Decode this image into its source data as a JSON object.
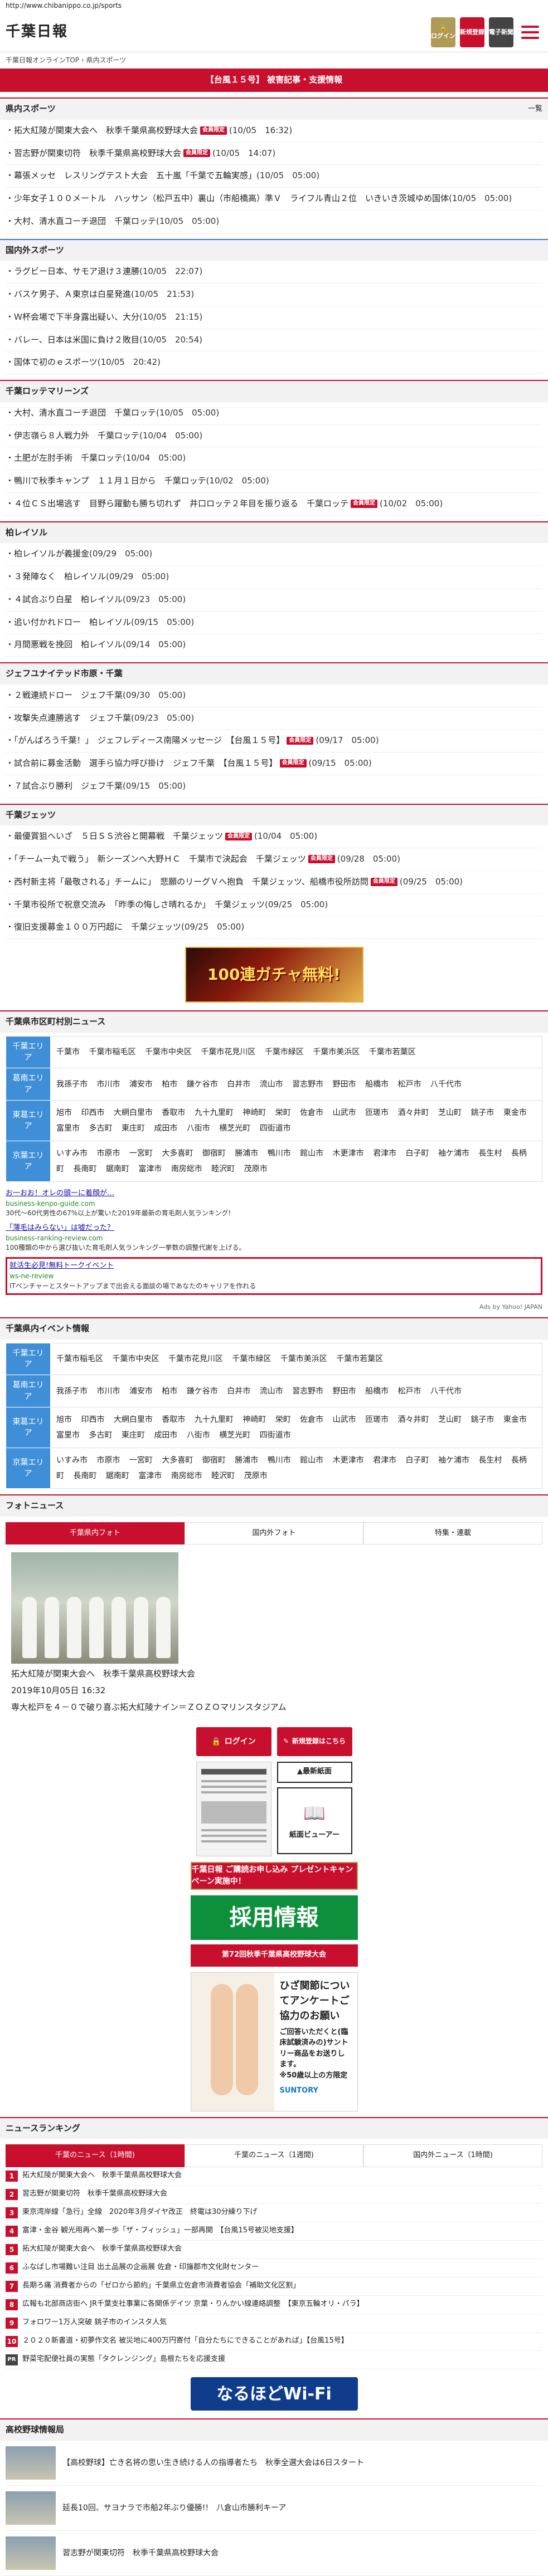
{
  "url": "http://www.chibanippo.co.jp/sports",
  "header": {
    "logo": "千葉日報",
    "login": "ログイン",
    "register": "新規登録",
    "eshimen": "電子新聞"
  },
  "breadcrumb": "千葉日報オンラインTOP › 県内スポーツ",
  "top_banner": "【台風１５号】 被害記事・支援情報",
  "sections": {
    "kennai": {
      "title": "県内スポーツ",
      "more": "一覧",
      "items": [
        {
          "text": "拓大紅陵が関東大会へ　秋季千葉県高校野球大会",
          "badge": "会員限定",
          "date": "(10/05　16:32)"
        },
        {
          "text": "習志野が関東切符　秋季千葉県高校野球大会",
          "badge": "会員限定",
          "date": "(10/05　14:07)"
        },
        {
          "text": "幕張メッセ　レスリングテスト大会　五十嵐「千葉で五輪実感」",
          "badge": "",
          "date": "(10/05　05:00)"
        },
        {
          "text": "少年女子１００メートル　ハッサン（松戸五中）裏山（市船橋高）準Ｖ　ライフル青山２位　いきいき茨城ゆめ国体",
          "badge": "",
          "date": "(10/05　05:00)"
        },
        {
          "text": "大村、清水直コーチ退団　千葉ロッテ",
          "badge": "",
          "date": "(10/05　05:00)"
        }
      ]
    },
    "kokunai": {
      "title": "国内外スポーツ",
      "items": [
        {
          "text": "ラグビー日本、サモア退け３連勝",
          "badge": "",
          "date": "(10/05　22:07)"
        },
        {
          "text": "バスケ男子、Ａ東京は白星発進",
          "badge": "",
          "date": "(10/05　21:53)"
        },
        {
          "text": "Ｗ杯会場で下半身露出疑い、大分",
          "badge": "",
          "date": "(10/05　21:15)"
        },
        {
          "text": "バレー、日本は米国に負け２敗目",
          "badge": "",
          "date": "(10/05　20:54)"
        },
        {
          "text": "国体で初のｅスポーツ",
          "badge": "",
          "date": "(10/05　20:42)"
        }
      ]
    },
    "lotte": {
      "title": "千葉ロッテマリーンズ",
      "items": [
        {
          "text": "大村、清水直コーチ退団　千葉ロッテ",
          "badge": "",
          "date": "(10/05　05:00)"
        },
        {
          "text": "伊志嶺ら８人戦力外　千葉ロッテ",
          "badge": "",
          "date": "(10/04　05:00)"
        },
        {
          "text": "土肥が左肘手術　千葉ロッテ",
          "badge": "",
          "date": "(10/04　05:00)"
        },
        {
          "text": "鴨川で秋季キャンプ　１１月１日から　千葉ロッテ",
          "badge": "",
          "date": "(10/02　05:00)"
        },
        {
          "text": "４位ＣＳ出場逃す　目野ら躍動も勝ち切れず　井口ロッテ２年目を振り返る　千葉ロッテ",
          "badge": "会員限定",
          "date": "(10/02　05:00)"
        }
      ]
    },
    "reysol": {
      "title": "柏レイソル",
      "items": [
        {
          "text": "柏レイソルが義援金",
          "badge": "",
          "date": "(09/29　05:00)"
        },
        {
          "text": "３発陣なく　柏レイソル",
          "badge": "",
          "date": "(09/29　05:00)"
        },
        {
          "text": "４試合ぶり白星　柏レイソル",
          "badge": "",
          "date": "(09/23　05:00)"
        },
        {
          "text": "追い付かれドロー　柏レイソル",
          "badge": "",
          "date": "(09/15　05:00)"
        },
        {
          "text": "月間悪戦を挽回　柏レイソル",
          "badge": "",
          "date": "(09/14　05:00)"
        }
      ]
    },
    "jef": {
      "title": "ジェフユナイテッド市原・千葉",
      "items": [
        {
          "text": "２戦連続ドロー　ジェフ千葉",
          "badge": "",
          "date": "(09/30　05:00)"
        },
        {
          "text": "攻撃失点連勝逃す　ジェフ千葉",
          "badge": "",
          "date": "(09/23　05:00)"
        },
        {
          "text": "「がんばろう千葉！」　ジェフレディース南陽メッセージ　【台風１５号】",
          "badge": "会員限定",
          "date": "(09/17　05:00)"
        },
        {
          "text": "試合前に募金活動　選手ら協力呼び掛け　ジェフ千葉　【台風１５号】",
          "badge": "会員限定",
          "date": "(09/15　05:00)"
        },
        {
          "text": "７試合ぶり勝利　ジェフ千葉",
          "badge": "",
          "date": "(09/15　05:00)"
        }
      ]
    },
    "jets": {
      "title": "千葉ジェッツ",
      "items": [
        {
          "text": "最優賞狙へいざ　５日ＳＳ渋谷と開幕戦　千葉ジェッツ",
          "badge": "会員限定",
          "date": "(10/04　05:00)"
        },
        {
          "text": "「チーム一丸で戦う」　新シーズンへ大野ＨＣ　千葉市で決起会　千葉ジェッツ",
          "badge": "会員限定",
          "date": "(09/28　05:00)"
        },
        {
          "text": "西村新主将「最敬される」チームに」　悲願のリーグＶへ抱負　千葉ジェッツ、船橋市役所訪問",
          "badge": "会員限定",
          "date": "(09/25　05:00)"
        },
        {
          "text": "千葉市役所で祝意交流み　「昨季の悔しさ晴れるか」　千葉ジェッツ",
          "badge": "",
          "date": "(09/25　05:00)"
        },
        {
          "text": "復旧支援募金１００万円超に　千葉ジェッツ",
          "badge": "",
          "date": "(09/25　05:00)"
        }
      ]
    }
  },
  "banner_ad": "100連ガチャ無料!",
  "region_news": {
    "title": "千葉県市区町村別ニュース",
    "rows": [
      {
        "area": "千葉エリア",
        "towns": [
          "千葉市",
          "千葉市稲毛区",
          "千葉市中央区",
          "千葉市花見川区",
          "千葉市緑区",
          "千葉市美浜区",
          "千葉市若葉区"
        ]
      },
      {
        "area": "葛南エリア",
        "towns": [
          "我孫子市",
          "市川市",
          "浦安市",
          "柏市",
          "鎌ケ谷市",
          "白井市",
          "流山市",
          "習志野市",
          "野田市",
          "船橋市",
          "松戸市",
          "八千代市"
        ]
      },
      {
        "area": "東葛エリア",
        "towns": [
          "旭市",
          "印西市",
          "大網白里市",
          "香取市",
          "九十九里町",
          "神崎町",
          "栄町",
          "佐倉市",
          "山武市",
          "匝瑳市",
          "酒々井町",
          "芝山町",
          "銚子市",
          "東金市",
          "富里市",
          "多古町",
          "東庄町",
          "成田市",
          "八街市",
          "横芝光町",
          "四街道市"
        ]
      },
      {
        "area": "京葉エリア",
        "towns": [
          "いすみ市",
          "市原市",
          "一宮町",
          "大多喜町",
          "御宿町",
          "勝浦市",
          "鴨川市",
          "館山市",
          "木更津市",
          "君津市",
          "白子町",
          "袖ケ浦市",
          "長生村",
          "長柄町",
          "長南町",
          "鋸南町",
          "富津市",
          "南房総市",
          "睦沢町",
          "茂原市"
        ]
      }
    ]
  },
  "ads": [
    {
      "title": "お一おお！オレの頭ーに着顔が…",
      "url": "business-kenpo-guide.com",
      "desc": "30代〜60代男性の67%以上が驚いた2019年最新の育毛剤人気ランキング!"
    },
    {
      "title": "「薄毛はみらない」は嘘だった？",
      "url": "business-ranking-review.com",
      "desc": "100種類の中から選び抜いた育毛剤人気ランキング一挙数の調整代謝を上げる。"
    },
    {
      "title": "就活生必見!無料トークイベント",
      "url": "ws-ne-review",
      "desc": "ITベンチャーとスタートアップまで出会える面談の場であなたのキャリアを作れる",
      "highlight": true
    }
  ],
  "ads_by": "Ads by Yahoo! JAPAN",
  "event_news": {
    "title": "千葉県内イベント情報",
    "rows": [
      {
        "area": "千葉エリア",
        "towns": [
          "千葉市稲毛区",
          "千葉市中央区",
          "千葉市花見川区",
          "千葉市緑区",
          "千葉市美浜区",
          "千葉市若葉区"
        ]
      },
      {
        "area": "葛南エリア",
        "towns": [
          "我孫子市",
          "市川市",
          "浦安市",
          "柏市",
          "鎌ケ谷市",
          "白井市",
          "流山市",
          "習志野市",
          "野田市",
          "船橋市",
          "松戸市",
          "八千代市"
        ]
      },
      {
        "area": "東葛エリア",
        "towns": [
          "旭市",
          "印西市",
          "大網白里市",
          "香取市",
          "九十九里町",
          "神崎町",
          "栄町",
          "佐倉市",
          "山武市",
          "匝瑳市",
          "酒々井町",
          "芝山町",
          "銚子市",
          "東金市",
          "富里市",
          "多古町",
          "東庄町",
          "成田市",
          "八街市",
          "横芝光町",
          "四街道市"
        ]
      },
      {
        "area": "京葉エリア",
        "towns": [
          "いすみ市",
          "市原市",
          "一宮町",
          "大多喜町",
          "御宿町",
          "勝浦市",
          "鴨川市",
          "館山市",
          "木更津市",
          "君津市",
          "白子町",
          "袖ケ浦市",
          "長生村",
          "長柄町",
          "長南町",
          "鋸南町",
          "富津市",
          "南房総市",
          "睦沢町",
          "茂原市"
        ]
      }
    ]
  },
  "photo_news": {
    "title": "フォトニュース",
    "tabs": [
      "千葉県内フォト",
      "国内外フォト",
      "特集・連載"
    ],
    "caption": "拓大紅陵が関東大会へ　秋季千葉県高校野球大会",
    "date": "2019年10月05日 16:32",
    "subcap": "専大松戸を４－０で破り喜ぶ拓大紅陵ナイン＝ＺＯＺＯマリンスタジアム"
  },
  "side": {
    "login": "ログイン",
    "register": "新規登録はこちら",
    "newest": "▲最新紙面",
    "viewer": "紙面ビューアー",
    "prize": "千葉日報 ご購読お申し込み プレゼントキャンペーン実施中！",
    "recruit": "採用情報",
    "tourney": "第72回秋季千葉県高校野球大会",
    "survey_big": "ひざ関節についてアンケートご協力のお願い",
    "survey_text": "ご回答いただくと(臨床試験済みの)サントリー商品をお送りします。",
    "survey_note": "※50歳以上の方限定",
    "survey_brand": "SUNTORY"
  },
  "ranking": {
    "title": "ニュースランキング",
    "tabs": [
      "千葉のニュース（1時間)",
      "千葉のニュース（1週間)",
      "国内外ニュース（1時間)"
    ],
    "items": [
      {
        "rank": "1",
        "text": "拓大紅陵が関東大会へ　秋季千葉県高校野球大会"
      },
      {
        "rank": "2",
        "text": "習志野が関東切符　秋季千葉県高校野球大会"
      },
      {
        "rank": "3",
        "text": "東京湾岸線「急行」全線　2020年3月ダイヤ改正　終電は30分繰り下げ"
      },
      {
        "rank": "4",
        "text": "富津・金谷 観光用再へ第一歩「ザ・フィッシュ」一部再開　【台風15号被災地支援】"
      },
      {
        "rank": "5",
        "text": "拓大紅陵が関東大会へ　秋季千葉県高校野球大会"
      },
      {
        "rank": "6",
        "text": "ふなばし市場難い注目 出土品展の企画展 佐倉・印旛郡市文化財センター"
      },
      {
        "rank": "7",
        "text": "長期ろ痛 消費者からの「ゼロから節約」千葉県立佐倉市消費者協会「補助文化区割」"
      },
      {
        "rank": "8",
        "text": "広報も北部商店街へ JR千葉支社事業に各関係デイツ 京葉・りんかい線連絡調整　【東京五輪オリ・パラ】"
      },
      {
        "rank": "9",
        "text": "フォロワー1万人突破 銚子市のインスタ人気"
      },
      {
        "rank": "10",
        "text": "２０２０新書道・初夢作文名 被災地に400万円寄付「自分たちにできることがあれば」【台風15号】"
      },
      {
        "rank": "PR",
        "text": "野菜宅配便社員の実態「タクレンジング」島根たちを応援支援"
      }
    ]
  },
  "wifi_banner": "なるほどWi-Fi",
  "highschool": {
    "title": "高校野球情報局",
    "items": [
      {
        "text": "【高校野球】亡き名将の思い生き続ける人の指導者たち　秋季全選大会は6日スタート"
      },
      {
        "text": "延長10回、サヨナラで市船2年ぶり優勝!!　八倉山市勝利キーア"
      },
      {
        "text": "習志野が関東切符　秋季千葉県高校野球大会"
      }
    ]
  }
}
